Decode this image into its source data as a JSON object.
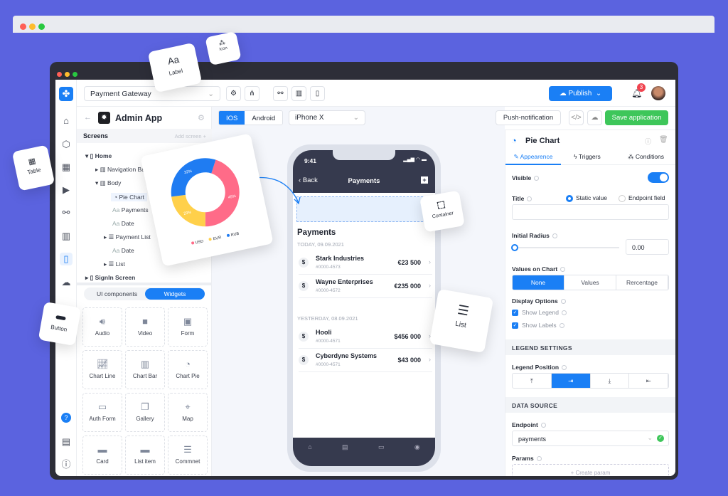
{
  "app": {
    "project": "Payment Gateway",
    "publish": "Publish",
    "notifications": "3",
    "platforms": [
      "IOS",
      "Android"
    ],
    "device": "iPhone X",
    "push": "Push-notification",
    "save": "Save application"
  },
  "left": {
    "app_name": "Admin App",
    "screens": "Screens",
    "add_screen": "Add screen",
    "tree": [
      "Home",
      "Navigation Bar",
      "Body",
      "Pie Chart",
      "Payments",
      "Date",
      "Payment List",
      "Date",
      "List",
      "SignIn Screen"
    ],
    "tabs": [
      "UI components",
      "Widgets"
    ],
    "widgets": [
      {
        "label": "Audio",
        "icon": "audio-file-icon"
      },
      {
        "label": "Video",
        "icon": "video-icon"
      },
      {
        "label": "Form",
        "icon": "image-icon"
      },
      {
        "label": "Chart Line",
        "icon": "line-chart-icon"
      },
      {
        "label": "Chart Bar",
        "icon": "bar-chart-icon"
      },
      {
        "label": "Chart Pie",
        "icon": "pie-chart-icon"
      },
      {
        "label": "Auth Form",
        "icon": "auth-form-icon"
      },
      {
        "label": "Gallery",
        "icon": "gallery-icon"
      },
      {
        "label": "Map",
        "icon": "map-pin-icon"
      },
      {
        "label": "Card",
        "icon": "card-icon"
      },
      {
        "label": "List item",
        "icon": "list-item-icon"
      },
      {
        "label": "Commnet",
        "icon": "comment-icon"
      }
    ]
  },
  "phone": {
    "time": "9:41",
    "back": "Back",
    "title": "Payments",
    "heading": "Payments",
    "groups": [
      {
        "date": "TODAY, 09.09.2021",
        "items": [
          {
            "name": "Stark Industries",
            "id": "#0000-4573",
            "amount": "€23 500"
          },
          {
            "name": "Wayne Enterprises",
            "id": "#0000-4572",
            "amount": "€235 000"
          }
        ]
      },
      {
        "date": "YESTERDAY, 08.09.2021",
        "items": [
          {
            "name": "Hooli",
            "id": "#0000-4571",
            "amount": "$456 000"
          },
          {
            "name": "Cyberdyne Systems",
            "id": "#0000-4571",
            "amount": "$43 000"
          }
        ]
      }
    ]
  },
  "right": {
    "title": "Pie Chart",
    "tabs": [
      "Appearence",
      "Triggers",
      "Conditions"
    ],
    "visible": "Visible",
    "visible_on": true,
    "title_label": "Title",
    "static": "Static value",
    "endpoint_field": "Endpoint field",
    "radius_label": "Initial Radius",
    "radius": "0.00",
    "radius_fraction": 0,
    "values_label": "Values on Chart",
    "values_opts": [
      "None",
      "Values",
      "Rercentage"
    ],
    "values_selected": "None",
    "display": "Display Options",
    "show_legend": "Show Legend",
    "show_labels": "Show Labels",
    "legend_settings": "LEGEND SETTINGS",
    "legend_pos": "Legend Position",
    "legend_selected": "right",
    "data_source": "DATA SOURCE",
    "endpoint_label": "Endpoint",
    "endpoint": "payments",
    "params": "Params",
    "create_param": "+ Create param"
  },
  "floating": {
    "label_aa": "Aa",
    "label": "Label",
    "icon": "Icon",
    "table": "Table",
    "button": "Button",
    "container": "Container",
    "list": "List"
  },
  "chart_data": {
    "type": "pie",
    "donut": true,
    "categories": [
      "USD",
      "EUR",
      "RUB"
    ],
    "values": [
      45,
      23,
      32
    ],
    "labels": [
      "45%",
      "23%",
      "32%"
    ],
    "colors": [
      "#ff6b88",
      "#ffd04a",
      "#1f7cf2"
    ],
    "legend": "bottom"
  }
}
